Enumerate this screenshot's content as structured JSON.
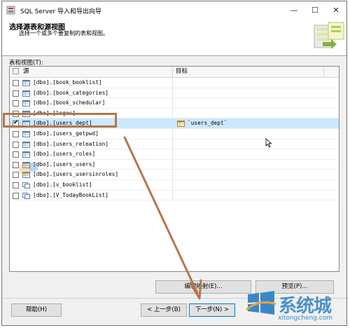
{
  "window": {
    "title": "SQL Server 导入和导出向导",
    "controls": {
      "minimize": "—",
      "maximize": "☐",
      "close": "✕"
    }
  },
  "header": {
    "title": "选择源表和源视图",
    "subtitle": "选择一个或多个要复制的表和视图。"
  },
  "tables_label": "表和视图(T):",
  "columns": {
    "source": "源",
    "target": "目标"
  },
  "rows": [
    {
      "source": "[dbo].[book_booklist]",
      "checked": false,
      "target": "",
      "selected": false,
      "icon": "table-icon"
    },
    {
      "source": "[dbo].[book_categories]",
      "checked": false,
      "target": "",
      "selected": false,
      "icon": "table-icon"
    },
    {
      "source": "[dbo].[book_schedular]",
      "checked": false,
      "target": "",
      "selected": false,
      "icon": "table-icon"
    },
    {
      "source": "[dbo].[logos]",
      "checked": false,
      "target": "",
      "selected": false,
      "icon": "table-icon"
    },
    {
      "source": "[dbo].[users_dept]",
      "checked": true,
      "target": "`users_dept`",
      "selected": true,
      "icon": "table-icon"
    },
    {
      "source": "[dbo].[users_getpwd]",
      "checked": false,
      "target": "",
      "selected": false,
      "icon": "table-icon"
    },
    {
      "source": "[dbo].[users_releation]",
      "checked": false,
      "target": "",
      "selected": false,
      "icon": "table-icon"
    },
    {
      "source": "[dbo].[users_roles]",
      "checked": false,
      "target": "",
      "selected": false,
      "icon": "table-icon"
    },
    {
      "source": "[dbo].[users_users]",
      "checked": false,
      "target": "",
      "selected": false,
      "icon": "table-icon"
    },
    {
      "source": "[dbo].[users_usersinroles]",
      "checked": false,
      "target": "",
      "selected": false,
      "icon": "table-icon"
    },
    {
      "source": "[dbo].[v_booklist]",
      "checked": false,
      "target": "",
      "selected": false,
      "icon": "view-icon"
    },
    {
      "source": "[dbo].[V_TodayBookList]",
      "checked": false,
      "target": "",
      "selected": false,
      "icon": "view-icon"
    }
  ],
  "buttons": {
    "edit_mapping": "编辑映射(E)...",
    "preview": "预览(P)...",
    "help": "帮助(H)",
    "back": "< 上一步(B)",
    "next": "下一步(N) >"
  },
  "watermark": {
    "text": "系统城",
    "url": "xitongcheng.com"
  },
  "colors": {
    "accent": "#0078d7",
    "selection": "#cce8ff",
    "annotation": "#b5764a",
    "watermark": "#3a87c8"
  }
}
